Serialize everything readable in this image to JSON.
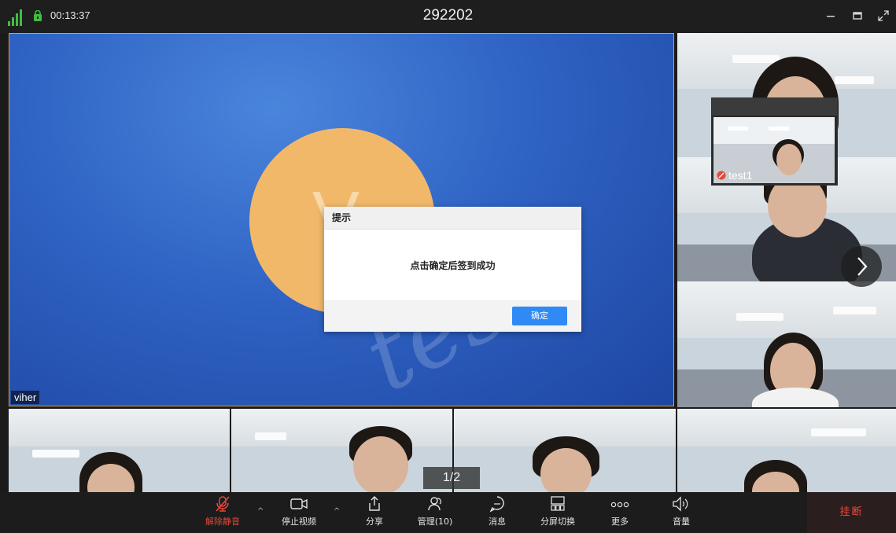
{
  "titlebar": {
    "timer": "00:13:37",
    "meeting_id": "292202",
    "signal_icon": "signal-bars-icon",
    "lock_icon": "lock-icon"
  },
  "main_video": {
    "participant_name": "viher",
    "avatar_letter": "V",
    "watermark_text": "test"
  },
  "dialog": {
    "title": "提示",
    "message": "点击确定后签到成功",
    "ok_label": "确定"
  },
  "pip": {
    "name": "test1"
  },
  "pagination": {
    "text": "1/2"
  },
  "toolbar": {
    "items": [
      {
        "label": "解除静音",
        "icon": "mic-muted-icon",
        "color": "#e8473a"
      },
      {
        "label": "停止视频",
        "icon": "camera-icon"
      },
      {
        "label": "分享",
        "icon": "share-icon"
      },
      {
        "label": "管理(10)",
        "icon": "participants-icon"
      },
      {
        "label": "消息",
        "icon": "chat-icon"
      },
      {
        "label": "分屏切换",
        "icon": "layout-switch-icon"
      },
      {
        "label": "更多",
        "icon": "more-icon"
      },
      {
        "label": "音量",
        "icon": "volume-icon"
      }
    ],
    "hangup_label": "挂断"
  },
  "colors": {
    "accent": "#2f8af5",
    "danger": "#e8473a",
    "active_border": "#c9a26a",
    "signal": "#3fbf3f"
  }
}
